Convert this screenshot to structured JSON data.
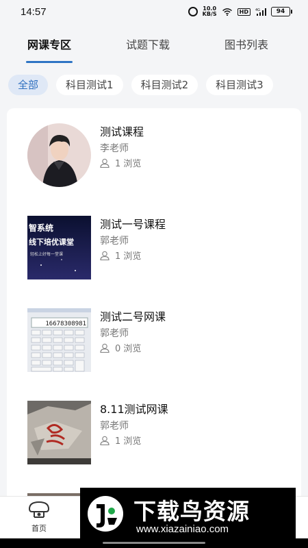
{
  "status_bar": {
    "time": "14:57",
    "speed_value": "10.0",
    "speed_unit": "KB/S",
    "hd": "HD",
    "signal_label": "4G",
    "battery": "94"
  },
  "tabs": [
    {
      "label": "网课专区",
      "active": true
    },
    {
      "label": "试题下载",
      "active": false
    },
    {
      "label": "图书列表",
      "active": false
    }
  ],
  "chips": [
    {
      "label": "全部",
      "active": true
    },
    {
      "label": "科目测试1",
      "active": false
    },
    {
      "label": "科目测试2",
      "active": false
    },
    {
      "label": "科目测试3",
      "active": false
    }
  ],
  "courses": [
    {
      "title": "测试课程",
      "teacher": "李老师",
      "views": "1 浏览"
    },
    {
      "title": "测试一号课程",
      "teacher": "郭老师",
      "views": "1 浏览"
    },
    {
      "title": "测试二号网课",
      "teacher": "郭老师",
      "views": "0 浏览"
    },
    {
      "title": "8.11测试网课",
      "teacher": "郭老师",
      "views": "1 浏览"
    }
  ],
  "thumbs": {
    "course2_line1": "智系统",
    "course2_line2": "线下培优课堂",
    "course2_line3": "轻松上好每一堂课",
    "calc_display": "16678308981"
  },
  "bottom_nav": {
    "home_label": "首页"
  },
  "watermark": {
    "title": "下载鸟资源",
    "url": "www.xiazainiao.com"
  },
  "colors": {
    "accent": "#2e74c4",
    "chip_active_bg": "#dfe8f6",
    "background": "#f4f5f7"
  }
}
